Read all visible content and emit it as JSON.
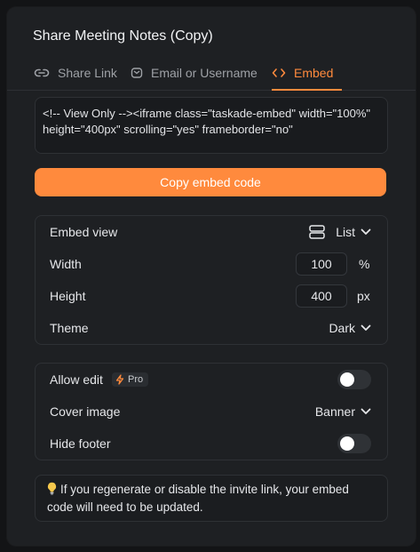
{
  "dialog": {
    "title": "Share Meeting Notes (Copy)"
  },
  "tabs": [
    {
      "label": "Share Link",
      "icon": "link-icon",
      "active": false
    },
    {
      "label": "Email or Username",
      "icon": "email-icon",
      "active": false
    },
    {
      "label": "Embed",
      "icon": "code-icon",
      "active": true
    }
  ],
  "embed": {
    "code": "<!-- View Only --><iframe class=\"taskade-embed\" width=\"100%\" height=\"400px\" scrolling=\"yes\" frameborder=\"no\"",
    "copy_label": "Copy embed code"
  },
  "settings": {
    "embed_view": {
      "label": "Embed view",
      "value": "List",
      "icon": "list-view-icon"
    },
    "width": {
      "label": "Width",
      "value": "100",
      "unit": "%"
    },
    "height": {
      "label": "Height",
      "value": "400",
      "unit": "px"
    },
    "theme": {
      "label": "Theme",
      "value": "Dark"
    }
  },
  "options": {
    "allow_edit": {
      "label": "Allow edit",
      "badge": "Pro",
      "enabled": false
    },
    "cover_image": {
      "label": "Cover image",
      "value": "Banner"
    },
    "hide_footer": {
      "label": "Hide footer",
      "enabled": false
    }
  },
  "info": {
    "icon": "lightbulb-icon",
    "text": "If you regenerate or disable the invite link, your embed code will need to be updated."
  },
  "colors": {
    "accent": "#ff8a3d",
    "background": "#1e2023"
  }
}
